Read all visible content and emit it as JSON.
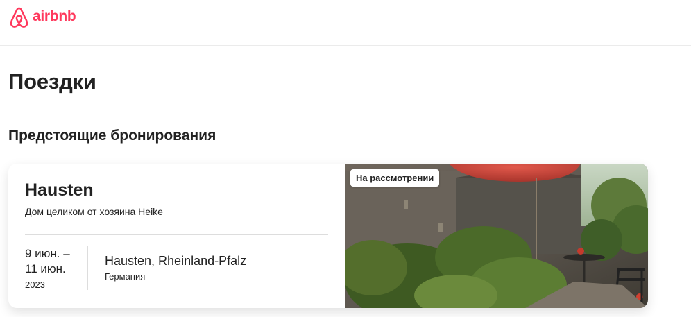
{
  "header": {
    "logo_text": "airbnb",
    "brand_color": "#FF385C"
  },
  "page": {
    "title": "Поездки"
  },
  "upcoming": {
    "section_title": "Предстоящие бронирования",
    "trips": [
      {
        "title": "Hausten",
        "subtitle": "Дом целиком от хозяина Heike",
        "date_start": "9 июн. –",
        "date_end": "11 июн.",
        "year": "2023",
        "city": "Hausten, Rheinland-Pfalz",
        "country": "Германия",
        "status_badge": "На рассмотрении",
        "image_icon": "garden-photo"
      }
    ]
  }
}
